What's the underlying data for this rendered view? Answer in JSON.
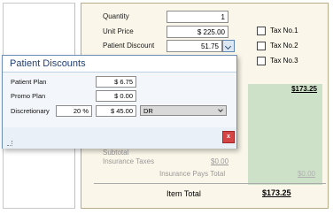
{
  "main": {
    "quantity": {
      "label": "Quantity",
      "value": "1"
    },
    "unit_price": {
      "label": "Unit Price",
      "value": "$ 225.00"
    },
    "patient_discount": {
      "label": "Patient Discount",
      "value": "51.75"
    },
    "taxes": [
      {
        "label": "Tax No.1"
      },
      {
        "label": "Tax No.2"
      },
      {
        "label": "Tax No.3"
      }
    ],
    "partial_value": "$173.25",
    "subtotal_label": "Subtotal",
    "insurance_taxes_label": "Insurance Taxes",
    "insurance_taxes_value": "$0.00",
    "insurance_pays_total_label": "Insurance Pays Total",
    "insurance_pays_total_value": "$0.00",
    "item_total_label": "Item Total",
    "item_total_value": "$173.25"
  },
  "popup": {
    "title": "Patient Discounts",
    "patient_plan": {
      "label": "Patient Plan",
      "value": "$ 6.75"
    },
    "promo_plan": {
      "label": "Promo Plan",
      "value": "$ 0.00"
    },
    "discretionary": {
      "label": "Discretionary",
      "percent": "20 %",
      "amount": "$ 45.00",
      "reason_selected": "DR"
    },
    "close_glyph": "x"
  },
  "colors": {
    "popup_title": "#1f3f73",
    "green_column": "#cde1c8",
    "close_button": "#d64545"
  }
}
